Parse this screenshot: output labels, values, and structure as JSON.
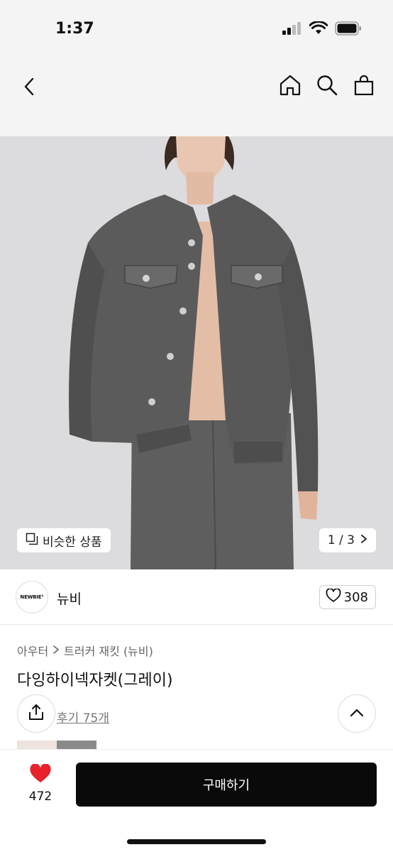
{
  "status": {
    "time": "1:37",
    "icons": [
      "signal-icon",
      "wifi-icon",
      "battery-icon"
    ]
  },
  "nav": {
    "icons": [
      "back-chevron-icon",
      "home-icon",
      "search-icon",
      "shopping-bag-icon"
    ]
  },
  "hero": {
    "similar_label": "비슷한 상품",
    "page_indicator": "1 / 3",
    "background_color": "#dcdbdd"
  },
  "shop": {
    "logo_text": "NEWBIE°",
    "name": "뉴비",
    "like_count": "308"
  },
  "product": {
    "breadcrumb": [
      "아우터",
      "트러커 재킷 (뉴비)"
    ],
    "title": "다잉하이넥자켓(그레이)",
    "review_link": "후기 75개"
  },
  "bottom_bar": {
    "wish_count": "472",
    "buy_label": "구매하기",
    "heart_color": "#e8222b"
  }
}
